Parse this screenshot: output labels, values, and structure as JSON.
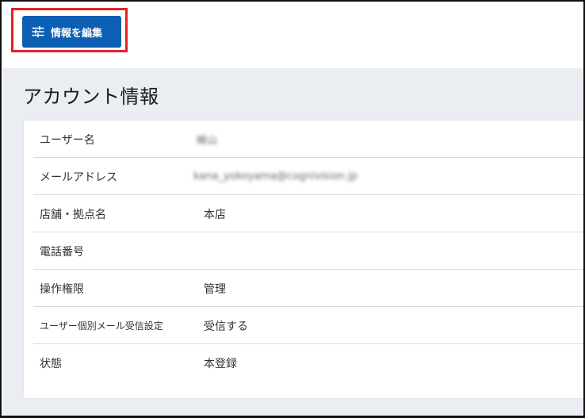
{
  "toolbar": {
    "edit_label": "情報を編集",
    "edit_icon": "sliders-icon",
    "button_color": "#0c5fb3",
    "highlight_color": "#e32226"
  },
  "page": {
    "title": "アカウント情報"
  },
  "account": {
    "rows": [
      {
        "label": "ユーザー名",
        "value": "綾山",
        "blurred": true
      },
      {
        "label": "メールアドレス",
        "value": "kana_yokoyama@cognivision.jp",
        "blurred": true
      },
      {
        "label": "店舗・拠点名",
        "value": "本店",
        "blurred": false
      },
      {
        "label": "電話番号",
        "value": "",
        "blurred": false
      },
      {
        "label": "操作権限",
        "value": "管理",
        "blurred": false
      },
      {
        "label": "ユーザー個別メール受信設定",
        "value": "受信する",
        "blurred": false
      },
      {
        "label": "状態",
        "value": "本登録",
        "blurred": false
      }
    ]
  }
}
